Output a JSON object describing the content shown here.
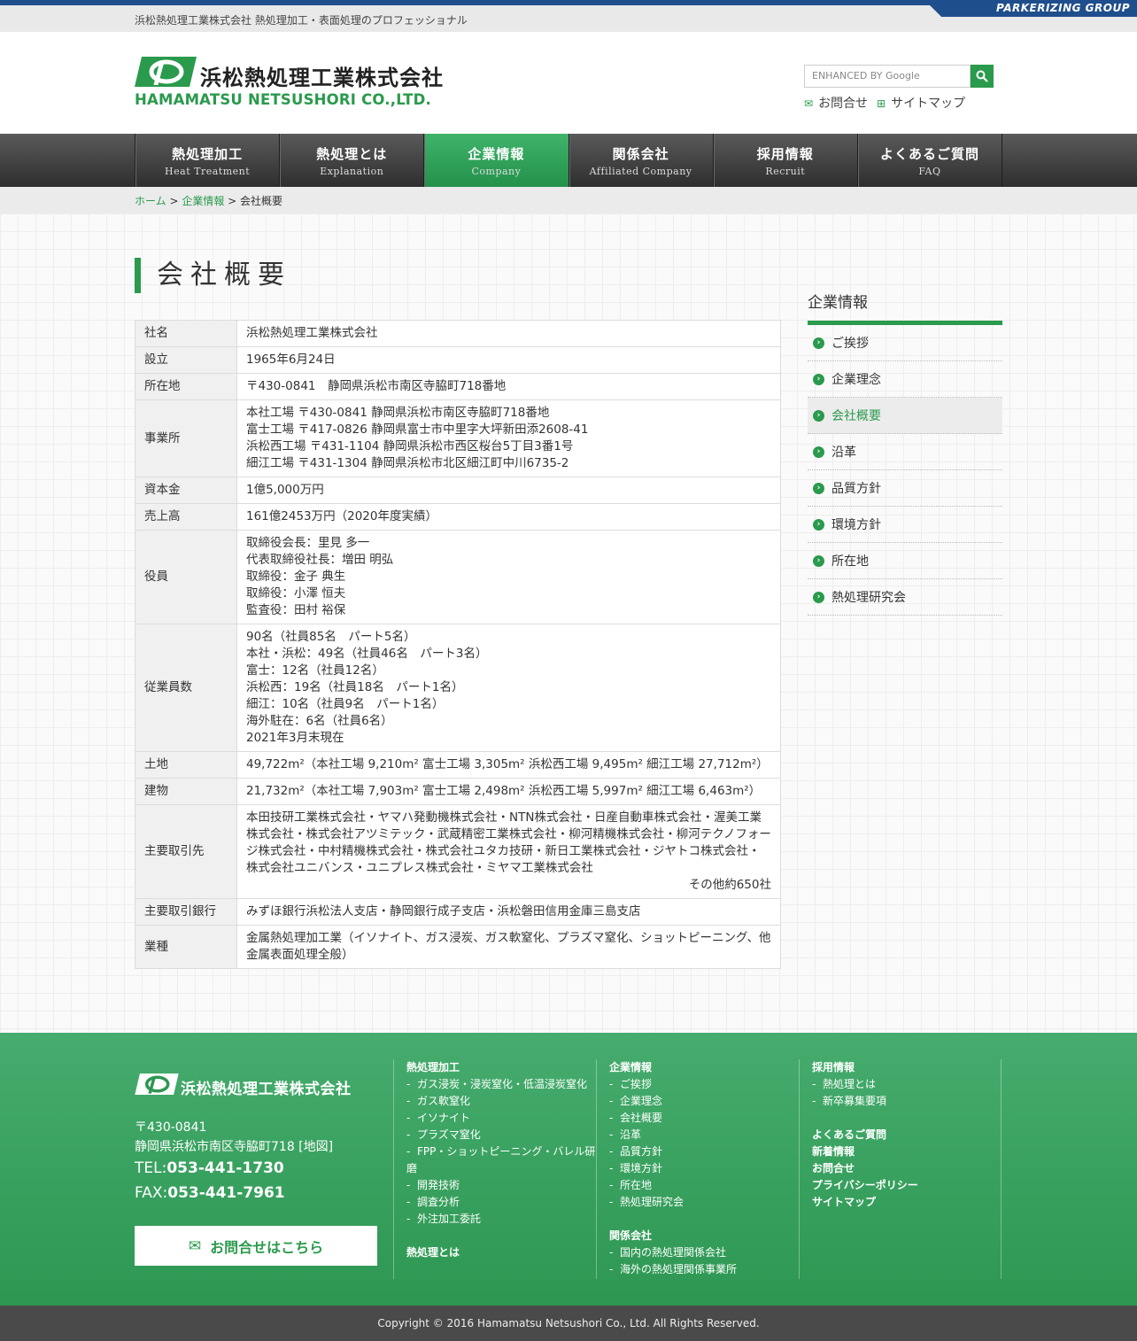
{
  "topbar": {
    "tagline": "浜松熱処理工業株式会社 熱処理加工・表面処理のプロフェッショナル",
    "group_badge": "PARKERIZING GROUP"
  },
  "logo": {
    "ja": "浜松熱処理工業株式会社",
    "en": "HAMAMATSU NETSUSHORI CO.,LTD."
  },
  "search": {
    "placeholder": "ENHANCED BY Google"
  },
  "header_links": {
    "contact": "お問合せ",
    "sitemap": "サイトマップ"
  },
  "nav": [
    {
      "ja": "熱処理加工",
      "en": "Heat Treatment"
    },
    {
      "ja": "熱処理とは",
      "en": "Explanation"
    },
    {
      "ja": "企業情報",
      "en": "Company"
    },
    {
      "ja": "関係会社",
      "en": "Affiliated Company"
    },
    {
      "ja": "採用情報",
      "en": "Recruit"
    },
    {
      "ja": "よくあるご質問",
      "en": "FAQ"
    }
  ],
  "breadcrumb": {
    "home": "ホーム",
    "sep": " > ",
    "company": "企業情報",
    "current": "会社概要"
  },
  "page_title": "会社概要",
  "table": {
    "r1": {
      "k": "社名",
      "v": "浜松熱処理工業株式会社"
    },
    "r2": {
      "k": "設立",
      "v": "1965年6月24日"
    },
    "r3": {
      "k": "所在地",
      "v": "〒430-0841　静岡県浜松市南区寺脇町718番地"
    },
    "r4": {
      "k": "事業所",
      "l1": "本社工場 〒430-0841 静岡県浜松市南区寺脇町718番地",
      "l2": "富士工場 〒417-0826 静岡県富士市中里字大坪新田添2608-41",
      "l3": "浜松西工場 〒431-1104 静岡県浜松市西区桜台5丁目3番1号",
      "l4": "細江工場 〒431-1304 静岡県浜松市北区細江町中川6735-2"
    },
    "r5": {
      "k": "資本金",
      "v": "1億5,000万円"
    },
    "r6": {
      "k": "売上高",
      "v": "161億2453万円（2020年度実績）"
    },
    "r7": {
      "k": "役員",
      "l1": "取締役会長：里見 多一",
      "l2": "代表取締役社長：増田 明弘",
      "l3": "取締役：金子 典生",
      "l4": "取締役：小澤 恒夫",
      "l5": "監査役：田村 裕保"
    },
    "r8": {
      "k": "従業員数",
      "l1": "90名（社員85名　パート5名）",
      "l2": "本社・浜松：49名（社員46名　パート3名）",
      "l3": "富士：12名（社員12名）",
      "l4": "浜松西：19名（社員18名　パート1名）",
      "l5": "細江：10名（社員9名　パート1名）",
      "l6": "海外駐在：6名（社員6名）",
      "l7": "2021年3月末現在"
    },
    "r9": {
      "k": "土地",
      "v": "49,722m²（本社工場 9,210m² 富士工場 3,305m² 浜松西工場 9,495m² 細江工場 27,712m²）"
    },
    "r10": {
      "k": "建物",
      "v": "21,732m²（本社工場 7,903m² 富士工場 2,498m² 浜松西工場 5,997m² 細江工場 6,463m²）"
    },
    "r11": {
      "k": "主要取引先",
      "v": "本田技研工業株式会社・ヤマハ発動機株式会社・NTN株式会社・日産自動車株式会社・渥美工業株式会社・株式会社アツミテック・武蔵精密工業株式会社・柳河精機株式会社・柳河テクノフォージ株式会社・中村精機株式会社・株式会社ユタカ技研・新日工業株式会社・ジヤトコ株式会社・株式会社ユニバンス・ユニプレス株式会社・ミヤマ工業株式会社",
      "note": "その他約650社"
    },
    "r12": {
      "k": "主要取引銀行",
      "v": "みずほ銀行浜松法人支店・静岡銀行成子支店・浜松磐田信用金庫三島支店"
    },
    "r13": {
      "k": "業種",
      "v": "金属熱処理加工業（イソナイト、ガス浸炭、ガス軟窒化、プラズマ窒化、ショットピーニング、他金属表面処理全般）"
    }
  },
  "sidebar": {
    "title": "企業情報",
    "items": [
      "ご挨拶",
      "企業理念",
      "会社概要",
      "沿革",
      "品質方針",
      "環境方針",
      "所在地",
      "熱処理研究会"
    ]
  },
  "footer": {
    "logo": "浜松熱処理工業株式会社",
    "zip": "〒430-0841",
    "address": "静岡県浜松市南区寺脇町718 [地図]",
    "tel_label": "TEL:",
    "tel": "053-441-1730",
    "fax_label": "FAX:",
    "fax": "053-441-7961",
    "contact_button": "お問合せはこちら",
    "col1": {
      "h": "熱処理加工",
      "items": [
        "ガス浸炭・浸炭窒化・低温浸炭窒化",
        "ガス軟窒化",
        "イソナイト",
        "プラズマ窒化",
        "FPP・ショットピーニング・バレル研磨",
        "開発技術",
        "調査分析",
        "外注加工委託"
      ],
      "h2": "熱処理とは"
    },
    "col2": {
      "h": "企業情報",
      "items": [
        "ご挨拶",
        "企業理念",
        "会社概要",
        "沿革",
        "品質方針",
        "環境方針",
        "所在地",
        "熱処理研究会"
      ],
      "h2": "関係会社",
      "items2": [
        "国内の熱処理関係会社",
        "海外の熱処理関係事業所"
      ]
    },
    "col3": {
      "h": "採用情報",
      "items": [
        "熱処理とは",
        "新卒募集要項"
      ],
      "links": [
        "よくあるご質問",
        "新着情報",
        "お問合せ",
        "プライバシーポリシー",
        "サイトマップ"
      ]
    },
    "copyright": "Copyright © 2016 Hamamatsu Netsushori Co., Ltd. All Rights Reserved."
  },
  "colors": {
    "brand_green": "#2a9a4c",
    "top_blue": "#1f4e8c",
    "nav_dark": "#3a3a3a"
  },
  "icons": [
    "search-icon",
    "mail-icon",
    "sitemap-icon",
    "chevron-right-icon"
  ]
}
